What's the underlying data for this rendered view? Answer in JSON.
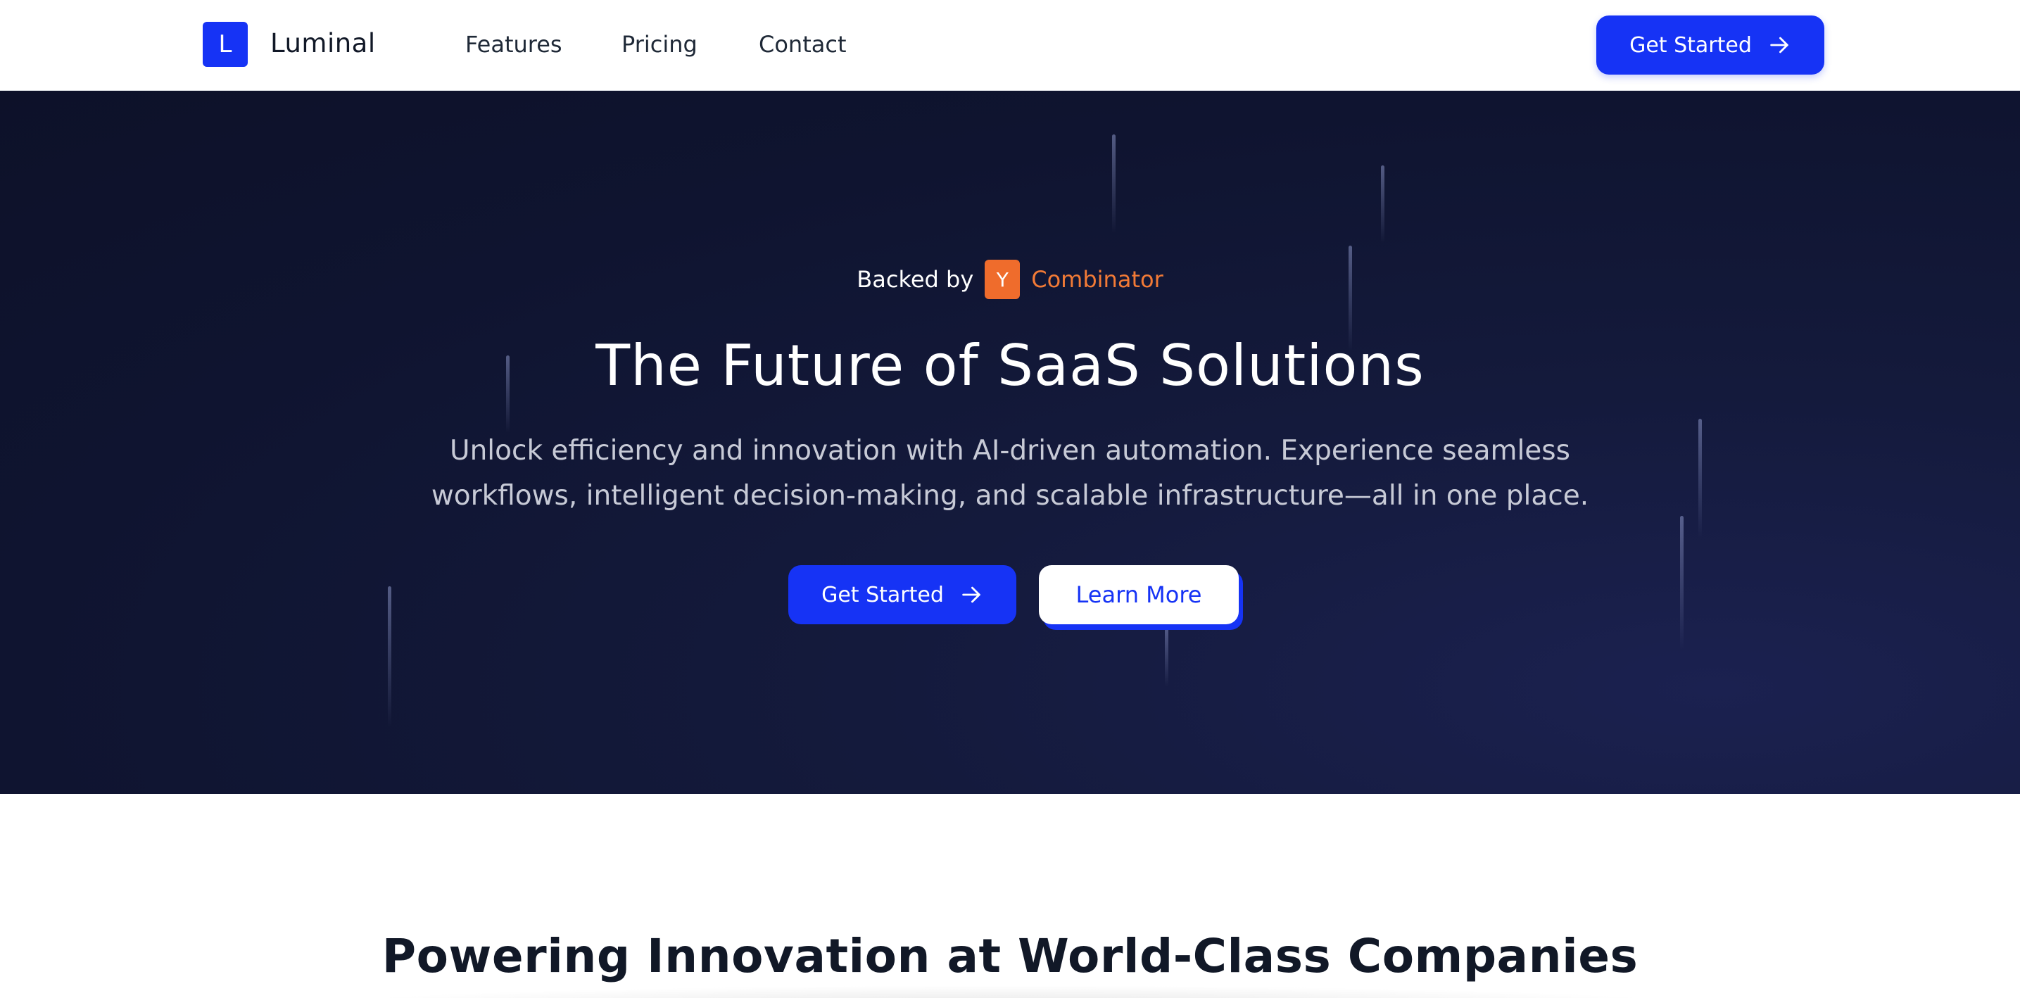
{
  "navbar": {
    "logo_letter": "L",
    "brand": "Luminal",
    "links": [
      "Features",
      "Pricing",
      "Contact"
    ],
    "cta_label": "Get Started"
  },
  "hero": {
    "backed_by_label": "Backed by",
    "yc_letter": "Y",
    "yc_name": "Combinator",
    "title": "The Future of SaaS Solutions",
    "subtitle": "Unlock efficiency and innovation with AI-driven automation. Experience seamless workflows, intelligent decision-making, and scalable infrastructure—all in one place.",
    "primary_cta": "Get Started",
    "secondary_cta": "Learn More"
  },
  "companies": {
    "title": "Powering Innovation at World-Class Companies"
  },
  "icons": {
    "arrow": "arrow-right-icon"
  },
  "colors": {
    "accent": "#1633f5",
    "yc_orange": "#ef6c2c",
    "hero_bg": "#0f1430"
  }
}
